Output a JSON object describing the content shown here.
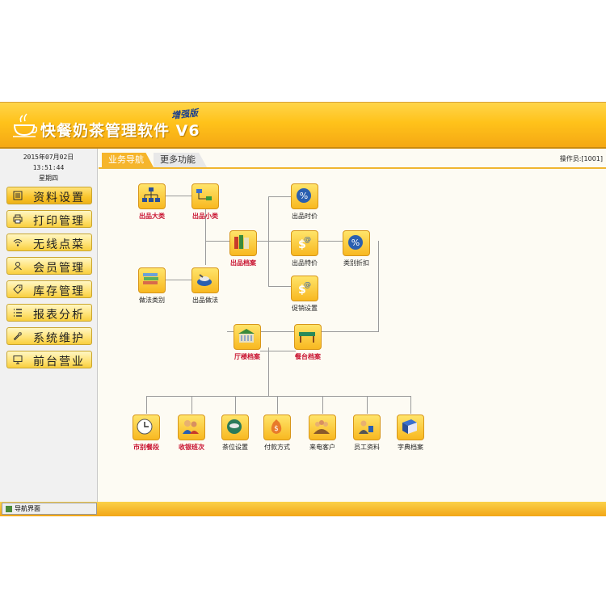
{
  "header": {
    "title": "快餐奶茶管理软件 V6",
    "edition": "增强版"
  },
  "sidebar": {
    "date": "2015年07月02日",
    "time": "13:51:44",
    "weekday": "星期四",
    "items": [
      {
        "label": "资料设置",
        "icon": "form-icon"
      },
      {
        "label": "打印管理",
        "icon": "printer-icon"
      },
      {
        "label": "无线点菜",
        "icon": "wifi-icon"
      },
      {
        "label": "会员管理",
        "icon": "user-icon"
      },
      {
        "label": "库存管理",
        "icon": "tag-icon"
      },
      {
        "label": "报表分析",
        "icon": "list-icon"
      },
      {
        "label": "系统维护",
        "icon": "wrench-icon"
      },
      {
        "label": "前台营业",
        "icon": "monitor-icon"
      }
    ]
  },
  "tabs": [
    {
      "label": "业务导航"
    },
    {
      "label": "更多功能"
    }
  ],
  "operator": "操作员:[1001]",
  "nodes": {
    "category": "出品大类",
    "subcategory": "出品小类",
    "archive": "出品档案",
    "method_category": "做法类别",
    "method": "出品做法",
    "time_price": "出品时价",
    "special_price": "出品特价",
    "category_discount": "类别折扣",
    "promotion": "促销设置",
    "hall": "厅楼档案",
    "table": "餐台档案",
    "shift": "市别餐段",
    "cashier_shift": "收银班次",
    "tea_seat": "茶位设置",
    "payment": "付款方式",
    "caller": "来电客户",
    "staff": "员工资料",
    "dictionary": "字典档案"
  },
  "status": {
    "tab": "导航界面"
  },
  "colors": {
    "accent": "#f6b52b",
    "header_gold": "#ffc21a",
    "highlight_red": "#c8102e"
  }
}
